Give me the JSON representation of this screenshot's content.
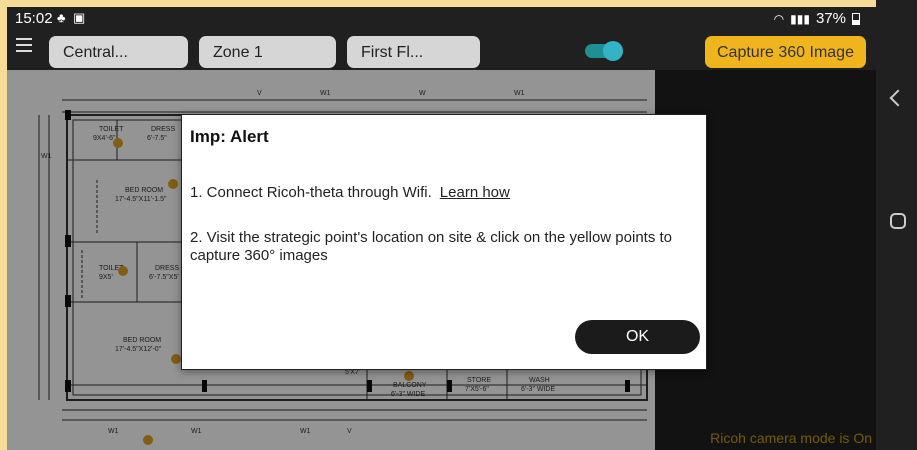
{
  "status_bar": {
    "time": "15:02",
    "battery": "37%"
  },
  "toolbar": {
    "dropdowns": [
      "Central...",
      "Zone 1",
      "First Fl..."
    ],
    "toggle_on": true,
    "capture_label": "Capture 360 Image"
  },
  "floor_plan": {
    "labels": {
      "toilet1": "TOILET",
      "toilet1_size": "9X4'-6\"",
      "dress1": "DRESS",
      "dress1_size": "6'-7.5\"",
      "bed1": "BED ROOM",
      "bed1_size": "17'-4.5\"X11'-1.5\"",
      "toilet2": "TOILET",
      "toilet2_size": "9X5'",
      "dress2": "DRESS",
      "dress2_size": "6'-7.5\"X5'",
      "bed2": "BED ROOM",
      "bed2_size": "17'-4.5\"X12'-0\"",
      "balcony": "BALCONY",
      "balcony_size": "6'-3\" WIDE",
      "store": "STORE",
      "store_size": "7'X5'-6\"",
      "wash": "WASH",
      "wash_size": "6'-3\" WIDE",
      "w1": "W1",
      "v": "V",
      "w": "W",
      "size_5x7": "5'X7'"
    },
    "dots_color": "#e0a024"
  },
  "right_panel": {
    "ricoh_status": "Ricoh camera mode is  On"
  },
  "dialog": {
    "title": "Imp: Alert",
    "step1": "1. Connect Ricoh-theta through Wifi.",
    "step1_link": "Learn how",
    "step2": "2. Visit the strategic point's location on site & click on the yellow points to capture 360° images",
    "ok_label": "OK"
  },
  "colors": {
    "accent": "#f0b51c",
    "frame": "#f6dc97",
    "toggle": "#32b4c4",
    "ricoh_text": "#c49a19"
  }
}
